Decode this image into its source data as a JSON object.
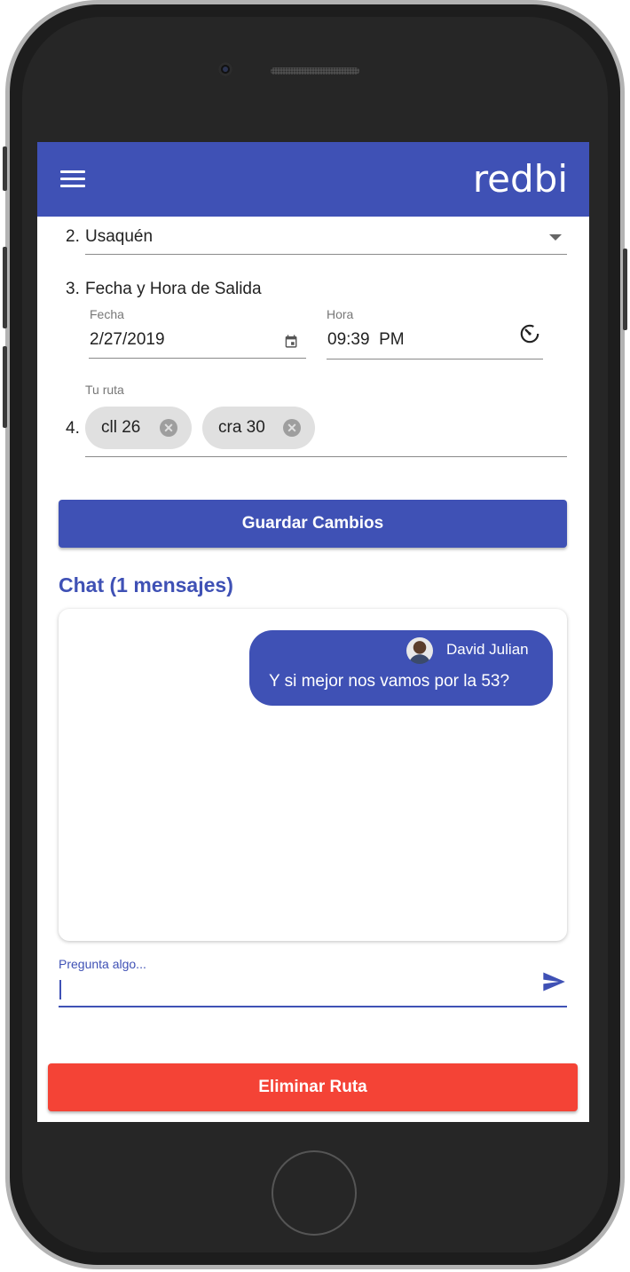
{
  "app": {
    "brand": "redbi"
  },
  "form": {
    "district": {
      "number": "2.",
      "value": "Usaquén"
    },
    "departure": {
      "number": "3.",
      "title": "Fecha y Hora de Salida",
      "date_label": "Fecha",
      "date_value": "2/27/2019",
      "time_label": "Hora",
      "time_value": "09:39  PM"
    },
    "route": {
      "number": "4.",
      "label": "Tu ruta",
      "chips": [
        "cll 26",
        "cra 30"
      ]
    },
    "save_label": "Guardar Cambios"
  },
  "chat": {
    "title": "Chat (1 mensajes)",
    "messages": [
      {
        "sender": "David Julian",
        "text": "Y si mejor nos vamos por la 53?"
      }
    ],
    "input_label": "Pregunta algo...",
    "input_value": ""
  },
  "delete_label": "Eliminar Ruta",
  "colors": {
    "primary": "#3f51b5",
    "danger": "#f44336",
    "chip": "#e0e0e0"
  },
  "icons": {
    "menu": "menu-icon",
    "calendar": "calendar-icon",
    "timer": "timer-icon",
    "send": "send-icon",
    "chip_remove": "cancel-circle-icon"
  }
}
